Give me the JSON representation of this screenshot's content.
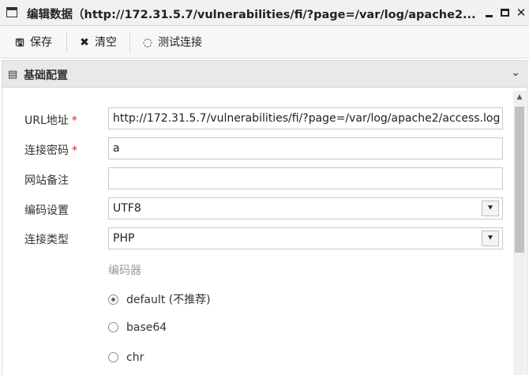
{
  "window": {
    "title": "编辑数据（http://172.31.5.7/vulnerabilities/fi/?page=/var/log/apache2...",
    "window_icon": "window-icon",
    "minimize_icon": "minimize-icon",
    "maximize_icon": "maximize-icon",
    "close_symbol": "✕"
  },
  "toolbar": {
    "save_label": "保存",
    "clear_label": "清空",
    "test_label": "测试连接",
    "save_icon_glyph": "💾",
    "clear_icon_glyph": "✖",
    "test_icon_glyph": "◌"
  },
  "section": {
    "title": "基础配置",
    "icon_glyph": "📄",
    "chevron_glyph": "⌄"
  },
  "form": {
    "url_label": "URL地址",
    "url_value": "http://172.31.5.7/vulnerabilities/fi/?page=/var/log/apache2/access.log",
    "password_label": "连接密码",
    "password_value": "a",
    "note_label": "网站备注",
    "note_value": "",
    "encoding_label": "编码设置",
    "encoding_value": "UTF8",
    "type_label": "连接类型",
    "type_value": "PHP",
    "required_mark": "*"
  },
  "encoder": {
    "heading": "编码器",
    "options": [
      {
        "label": "default (不推荐)",
        "checked": true
      },
      {
        "label": "base64",
        "checked": false
      },
      {
        "label": "chr",
        "checked": false
      }
    ]
  },
  "colors": {
    "required": "#e02020",
    "titlebar_bg": "#f1f1f1",
    "section_bg": "#e9e9e9"
  }
}
